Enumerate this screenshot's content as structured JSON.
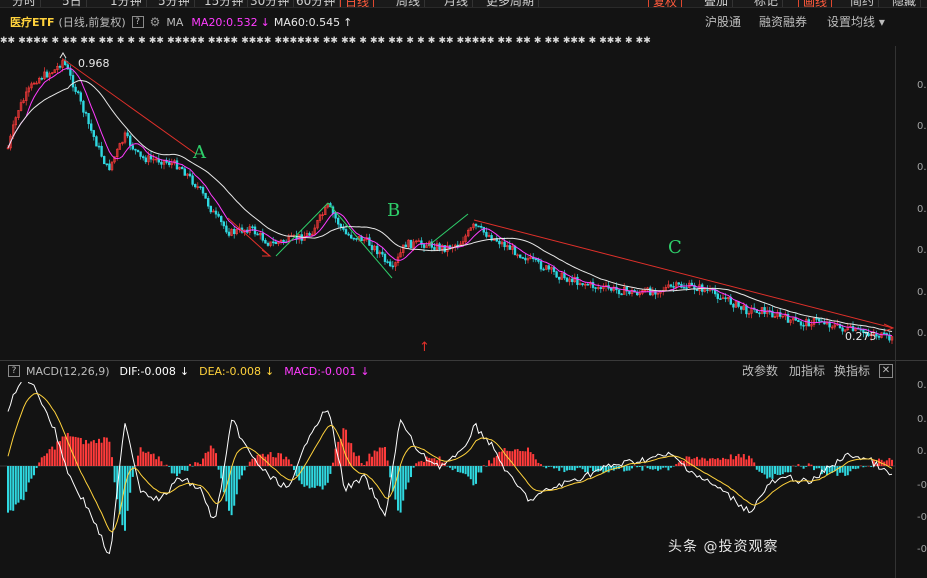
{
  "top_tabs": [
    {
      "label": "分时",
      "active": false
    },
    {
      "label": "5日",
      "active": false
    },
    {
      "label": "1分钟",
      "active": false
    },
    {
      "label": "5分钟",
      "active": false
    },
    {
      "label": "15分钟",
      "active": false
    },
    {
      "label": "30分钟",
      "active": false
    },
    {
      "label": "60分钟",
      "active": false
    },
    {
      "label": "日线",
      "active": true
    },
    {
      "label": "周线",
      "active": false
    },
    {
      "label": "月线",
      "active": false
    },
    {
      "label": "更多周期",
      "active": false
    },
    {
      "label": "复权",
      "active": true
    },
    {
      "label": "叠加",
      "active": false
    },
    {
      "label": "标记",
      "active": false
    },
    {
      "label": "画线",
      "active": true
    },
    {
      "label": "简约",
      "active": false
    },
    {
      "label": "隐藏",
      "active": false
    }
  ],
  "info": {
    "name": "医疗ETF",
    "sub": "(日线,前复权)",
    "help": "?",
    "ma_label": "MA",
    "ma20": "MA20:0.532",
    "ma20_arrow": "↓",
    "ma60": "MA60:0.545",
    "ma60_arrow": "↑",
    "links": [
      "沪股通",
      "融资融券",
      "设置均线 ▾"
    ]
  },
  "dots": "✱✱ ✱✱✱✱ ✱ ✱✱ ✱✱   ✱✱  ✱  ✱ ✱ ✱✱ ✱✱✱✱✱ ✱✱✱✱ ✱✱✱✱  ✱✱✱✱✱✱ ✱✱   ✱✱ ✱ ✱✱  ✱✱ ✱ ✱ ✱   ✱✱  ✱✱✱✱✱  ✱✱ ✱✱ ✱  ✱✱ ✱✱✱ ✱  ✱✱✱ ✱ ✱✱",
  "annotations": {
    "high": "0.968",
    "low": "0.275",
    "wave_a": "A",
    "wave_b": "B",
    "wave_c": "C",
    "up_arrow": "↑"
  },
  "price_axis": [
    "0.",
    "0.",
    "0.",
    "0.",
    "0.",
    "0.",
    "0."
  ],
  "macd": {
    "help": "?",
    "title": "MACD(12,26,9)",
    "dif": "DIF:-0.008",
    "dif_arrow": "↓",
    "dea": "DEA:-0.008",
    "dea_arrow": "↓",
    "macd": "MACD:-0.001",
    "macd_arrow": "↓",
    "links": [
      "改参数",
      "加指标",
      "换指标"
    ],
    "close": "✕",
    "axis": [
      "0.",
      "0.",
      "0.",
      "-0.",
      "-0.",
      "-0."
    ]
  },
  "colors": {
    "up": "#ff3b3b",
    "down": "#2fd8e0",
    "ma20": "#ff3cff",
    "ma60": "#e8e8e8",
    "trendline": "#e0302a",
    "wave_label": "#2ecf6a"
  },
  "watermark": "头条 @投资观察"
}
